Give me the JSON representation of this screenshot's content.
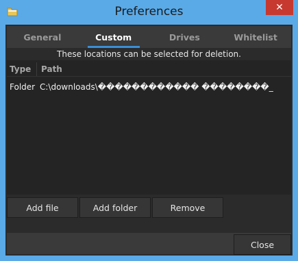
{
  "window": {
    "title": "Preferences",
    "close_glyph": "✕",
    "app_icon": "folder-icon"
  },
  "tabs": [
    {
      "label": "General",
      "active": false
    },
    {
      "label": "Custom",
      "active": true
    },
    {
      "label": "Drives",
      "active": false
    },
    {
      "label": "Whitelist",
      "active": false
    }
  ],
  "info_text": "These locations can be selected for deletion.",
  "list": {
    "columns": [
      "Type",
      "Path"
    ],
    "rows": [
      {
        "type": "Folder",
        "path": "C:\\downloads\\������������ ��������_"
      }
    ]
  },
  "buttons": {
    "add_file": "Add file",
    "add_folder": "Add folder",
    "remove": "Remove",
    "close": "Close"
  },
  "colors": {
    "accent": "#3b8fd6",
    "titlebar": "#5aaae8",
    "close_red": "#c7392f",
    "panel": "#2b2b2b"
  }
}
